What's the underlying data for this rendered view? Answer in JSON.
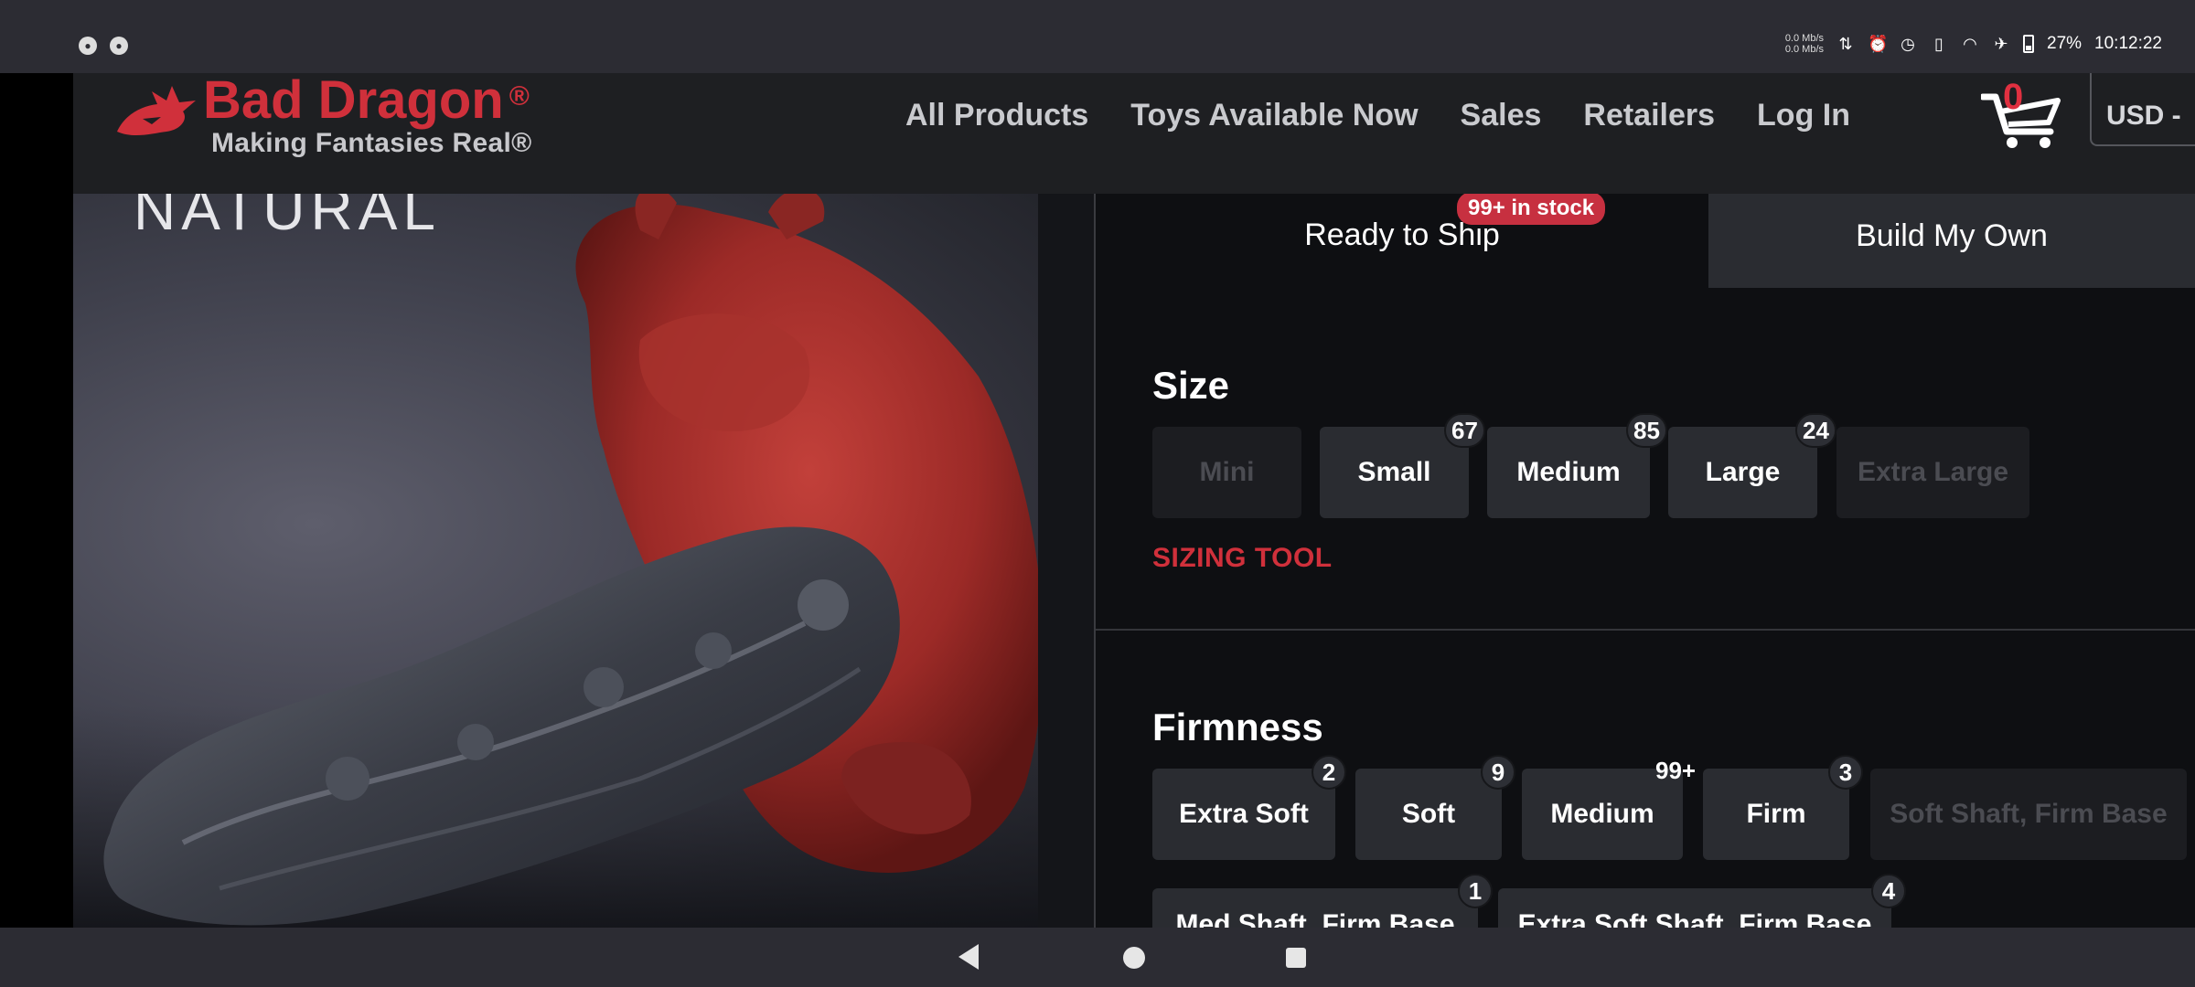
{
  "status_bar": {
    "net_up": "0.0 Mb/s",
    "net_down": "0.0 Mb/s",
    "battery": "27%",
    "time": "10:12:22"
  },
  "header": {
    "brand": "Bad Dragon",
    "brand_mark": "®",
    "tagline": "Making Fantasies Real®",
    "nav": [
      "All Products",
      "Toys Available Now",
      "Sales",
      "Retailers",
      "Log In"
    ],
    "cart_count": "0",
    "currency": "USD -",
    "brand_color": "#d0303b"
  },
  "product_image": {
    "overlay_text": "NATURAL"
  },
  "tabs": {
    "ready": "Ready to Ship",
    "stock_badge": "99+ in stock",
    "build": "Build My Own"
  },
  "size": {
    "title": "Size",
    "options": [
      {
        "label": "Mini",
        "count": "",
        "disabled": true
      },
      {
        "label": "Small",
        "count": "67",
        "disabled": false
      },
      {
        "label": "Medium",
        "count": "85",
        "disabled": false
      },
      {
        "label": "Large",
        "count": "24",
        "disabled": false
      },
      {
        "label": "Extra Large",
        "count": "",
        "disabled": true
      }
    ],
    "sizing_tool": "SIZING TOOL"
  },
  "firmness": {
    "title": "Firmness",
    "options": [
      {
        "label": "Extra Soft",
        "count": "2",
        "disabled": false
      },
      {
        "label": "Soft",
        "count": "9",
        "disabled": false
      },
      {
        "label": "Medium",
        "count": "99+",
        "disabled": false
      },
      {
        "label": "Firm",
        "count": "3",
        "disabled": false
      },
      {
        "label": "Soft Shaft, Firm Base",
        "count": "",
        "disabled": true
      },
      {
        "label": "Med Shaft, Firm Base",
        "count": "1",
        "disabled": false
      },
      {
        "label": "Extra Soft Shaft, Firm Base",
        "count": "4",
        "disabled": false
      }
    ]
  }
}
